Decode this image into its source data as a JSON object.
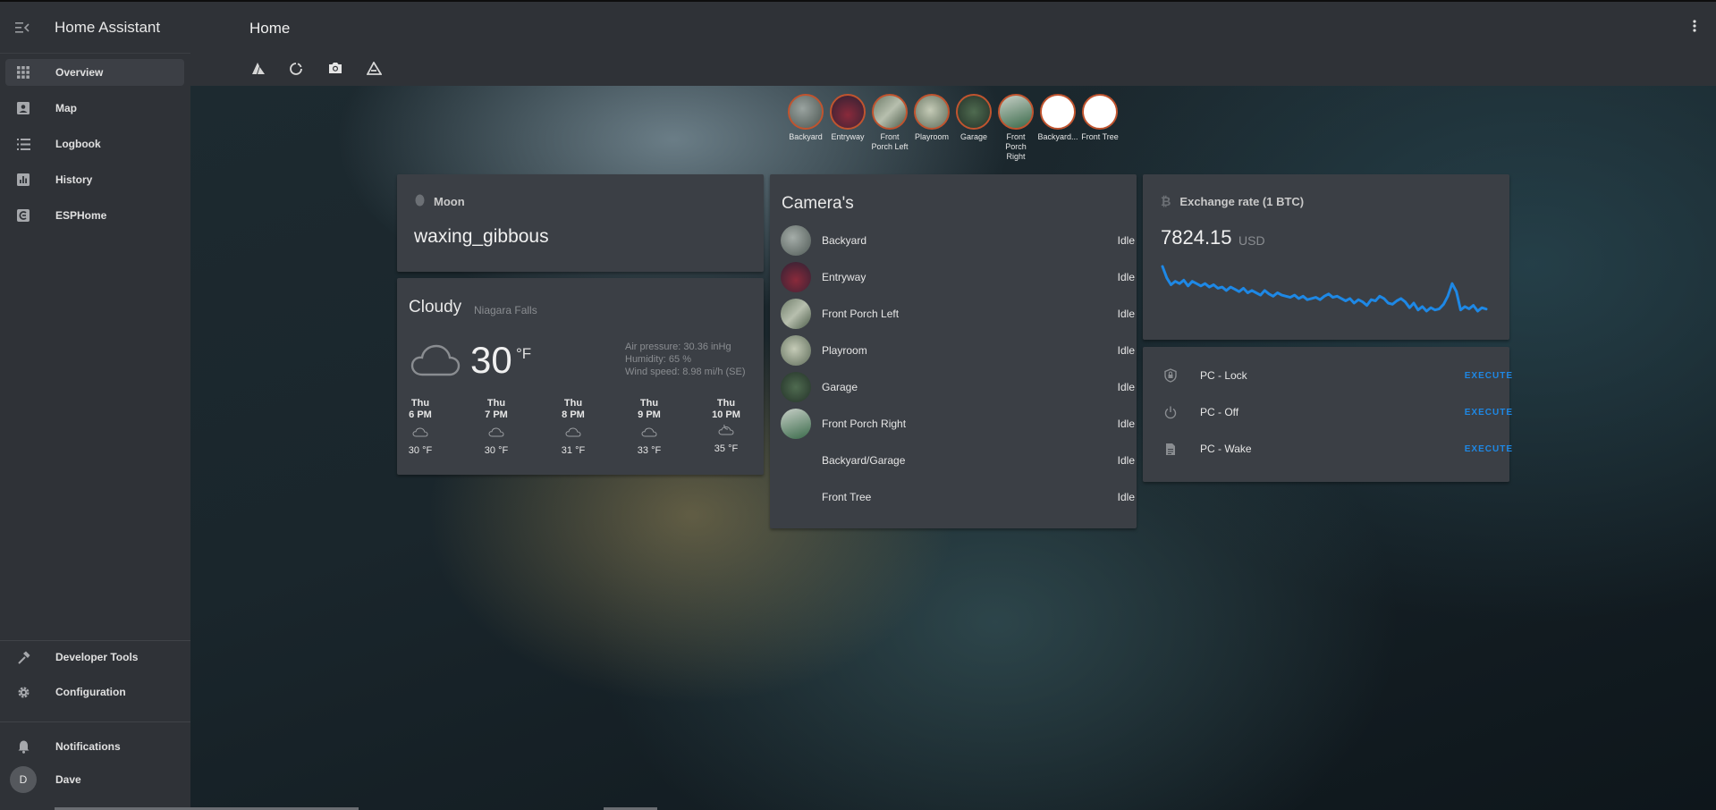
{
  "app": {
    "title": "Home Assistant"
  },
  "sidebar": {
    "items": [
      {
        "label": "Overview",
        "icon": "apps-grid-icon"
      },
      {
        "label": "Map",
        "icon": "account-box-icon"
      },
      {
        "label": "Logbook",
        "icon": "format-list-icon"
      },
      {
        "label": "History",
        "icon": "chart-box-icon"
      },
      {
        "label": "ESPHome",
        "icon": "esphome-icon"
      }
    ],
    "bottom_items": [
      {
        "label": "Developer Tools",
        "icon": "hammer-icon"
      },
      {
        "label": "Configuration",
        "icon": "gear-icon"
      }
    ],
    "notifications": "Notifications",
    "user": {
      "initial": "D",
      "name": "Dave"
    }
  },
  "header": {
    "title": "Home",
    "tabs": [
      "mountain-icon",
      "circle-icon",
      "camera-icon",
      "delta-icon"
    ],
    "active_tab": 2
  },
  "camera_badges": [
    "Backyard",
    "Entryway",
    "Front Porch Left",
    "Playroom",
    "Garage",
    "Front Porch Right",
    "Backyard...",
    "Front Tree"
  ],
  "moon_card": {
    "title": "Moon",
    "state": "waxing_gibbous"
  },
  "weather_card": {
    "condition": "Cloudy",
    "location": "Niagara Falls",
    "temperature": "30",
    "unit": "°F",
    "attributes": [
      "Air pressure: 30.36 inHg",
      "Humidity: 65 %",
      "Wind speed: 8.98 mi/h (SE)"
    ],
    "forecast": [
      {
        "day": "Thu",
        "time": "6 PM",
        "temp": "30 °F",
        "icon": "cloud-icon"
      },
      {
        "day": "Thu",
        "time": "7 PM",
        "temp": "30 °F",
        "icon": "cloud-icon"
      },
      {
        "day": "Thu",
        "time": "8 PM",
        "temp": "31 °F",
        "icon": "cloud-icon"
      },
      {
        "day": "Thu",
        "time": "9 PM",
        "temp": "33 °F",
        "icon": "cloud-icon"
      },
      {
        "day": "Thu",
        "time": "10 PM",
        "temp": "35 °F",
        "icon": "night-partly-cloudy-icon"
      }
    ]
  },
  "cameras_card": {
    "title": "Camera's",
    "rows": [
      {
        "name": "Backyard",
        "state": "Idle"
      },
      {
        "name": "Entryway",
        "state": "Idle"
      },
      {
        "name": "Front Porch Left",
        "state": "Idle"
      },
      {
        "name": "Playroom",
        "state": "Idle"
      },
      {
        "name": "Garage",
        "state": "Idle"
      },
      {
        "name": "Front Porch Right",
        "state": "Idle"
      },
      {
        "name": "Backyard/Garage",
        "state": "Idle"
      },
      {
        "name": "Front Tree",
        "state": "Idle"
      }
    ]
  },
  "btc_card": {
    "title": "Exchange rate (1 BTC)",
    "value": "7824.15",
    "currency": "USD",
    "history": [
      8010,
      7960,
      7930,
      7945,
      7935,
      7950,
      7925,
      7945,
      7935,
      7925,
      7935,
      7920,
      7930,
      7915,
      7920,
      7905,
      7920,
      7910,
      7900,
      7915,
      7895,
      7905,
      7895,
      7885,
      7905,
      7890,
      7880,
      7895,
      7885,
      7880,
      7875,
      7885,
      7870,
      7880,
      7865,
      7870,
      7875,
      7865,
      7880,
      7890,
      7875,
      7880,
      7870,
      7860,
      7870,
      7850,
      7865,
      7855,
      7840,
      7865,
      7860,
      7880,
      7870,
      7850,
      7845,
      7860,
      7870,
      7855,
      7830,
      7850,
      7820,
      7835,
      7815,
      7830,
      7820,
      7825,
      7845,
      7880,
      7935,
      7900,
      7820,
      7835,
      7825,
      7840,
      7815,
      7830,
      7824
    ]
  },
  "scripts_card": {
    "rows": [
      {
        "name": "PC - Lock",
        "icon": "shield-lock-icon",
        "action": "EXECUTE"
      },
      {
        "name": "PC - Off",
        "icon": "power-icon",
        "action": "EXECUTE"
      },
      {
        "name": "PC - Wake",
        "icon": "file-document-icon",
        "action": "EXECUTE"
      }
    ]
  },
  "colors": {
    "accent": "#1e88e5",
    "badge_border": "#c0542f",
    "card": "#3b3f45",
    "sidebar": "#2f3237"
  }
}
